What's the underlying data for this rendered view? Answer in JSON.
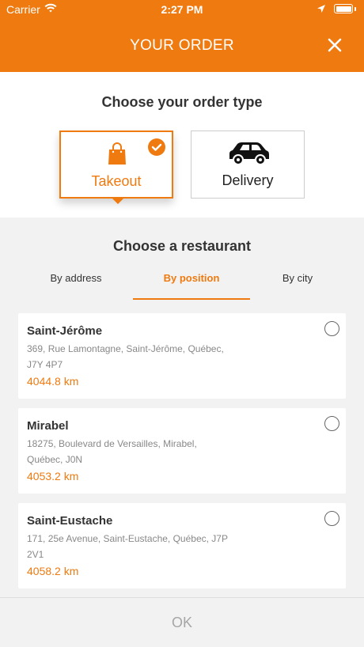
{
  "status_bar": {
    "carrier": "Carrier",
    "time": "2:27 PM",
    "icons": [
      "wifi-icon",
      "location-arrow-icon",
      "battery-icon"
    ]
  },
  "header": {
    "title": "YOUR ORDER",
    "close_icon": "close-icon"
  },
  "order_type": {
    "heading": "Choose your order type",
    "options": [
      {
        "label": "Takeout",
        "icon": "shopping-bag-icon",
        "selected": true
      },
      {
        "label": "Delivery",
        "icon": "car-icon",
        "selected": false
      }
    ]
  },
  "restaurant": {
    "heading": "Choose a restaurant",
    "tabs": [
      {
        "label": "By address",
        "active": false
      },
      {
        "label": "By position",
        "active": true
      },
      {
        "label": "By city",
        "active": false
      }
    ],
    "items": [
      {
        "name": "Saint-Jérôme",
        "address_line1": "369, Rue Lamontagne, Saint-Jérôme, Québec,",
        "address_line2": "J7Y 4P7",
        "distance": "4044.8 km"
      },
      {
        "name": "Mirabel",
        "address_line1": "18275, Boulevard de Versailles, Mirabel,",
        "address_line2": "Québec, J0N",
        "distance": "4053.2 km"
      },
      {
        "name": "Saint-Eustache",
        "address_line1": "171, 25e Avenue, Saint-Eustache, Québec, J7P",
        "address_line2": "2V1",
        "distance": "4058.2 km"
      }
    ]
  },
  "footer": {
    "ok_label": "OK"
  },
  "colors": {
    "accent": "#ef7a10",
    "background": "#f2f2f2",
    "text": "#333333",
    "muted": "#888888"
  }
}
